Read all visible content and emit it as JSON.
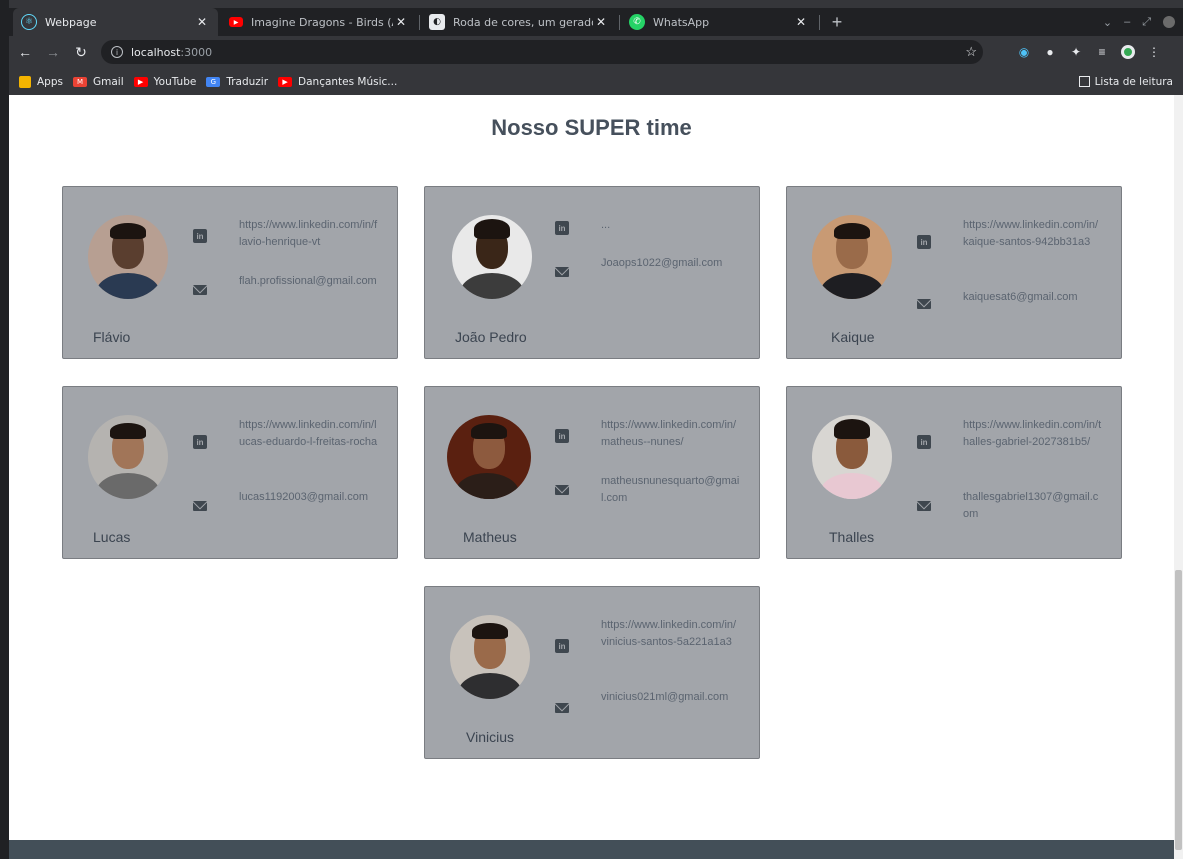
{
  "browser": {
    "tabs": [
      {
        "title": "Webpage",
        "active": true,
        "favicon": "react-icon"
      },
      {
        "title": "Imagine Dragons - Birds (Anim",
        "active": false,
        "favicon": "youtube-icon"
      },
      {
        "title": "Roda de cores, um gerador de",
        "active": false,
        "favicon": "color-wheel-icon"
      },
      {
        "title": "WhatsApp",
        "active": false,
        "favicon": "whatsapp-icon"
      }
    ],
    "address": {
      "host": "localhost",
      "port": ":3000"
    },
    "bookmarks": [
      {
        "label": "Apps",
        "icon": "apps-icon",
        "color": "#f4b400"
      },
      {
        "label": "Gmail",
        "icon": "gmail-icon",
        "color": "#ea4335"
      },
      {
        "label": "YouTube",
        "icon": "youtube-icon",
        "color": "#ff0000"
      },
      {
        "label": "Traduzir",
        "icon": "translate-icon",
        "color": "#4285f4"
      },
      {
        "label": "Dançantes Músic...",
        "icon": "youtube-icon",
        "color": "#ff0000"
      }
    ],
    "reading_list": "Lista de leitura"
  },
  "page": {
    "title": "Nosso SUPER time"
  },
  "team": [
    {
      "name": "Flávio",
      "linkedin": "https://www.linkedin.com/in/flavio-henrique-vt",
      "email": "flah.profissional@gmail.com"
    },
    {
      "name": "João Pedro",
      "linkedin": "...",
      "email": "Joaops1022@gmail.com"
    },
    {
      "name": "Kaique",
      "linkedin": "https://www.linkedin.com/in/kaique-santos-942bb31a3",
      "email": "kaiquesat6@gmail.com"
    },
    {
      "name": "Lucas",
      "linkedin": "https://www.linkedin.com/in/lucas-eduardo-l-freitas-rocha",
      "email": "lucas1192003@gmail.com"
    },
    {
      "name": "Matheus",
      "linkedin": "https://www.linkedin.com/in/matheus--nunes/",
      "email": "matheusnunesquarto@gmail.com"
    },
    {
      "name": "Thalles",
      "linkedin": "https://www.linkedin.com/in/thalles-gabriel-2027381b5/",
      "email": "thallesgabriel1307@gmail.com"
    },
    {
      "name": "Vinicius",
      "linkedin": "https://www.linkedin.com/in/vinicius-santos-5a221a1a3",
      "email": "vinicius021ml@gmail.com"
    }
  ],
  "colors": {
    "card_bg": "#a2a5aa",
    "title": "#46505c",
    "footer": "#434f58"
  }
}
